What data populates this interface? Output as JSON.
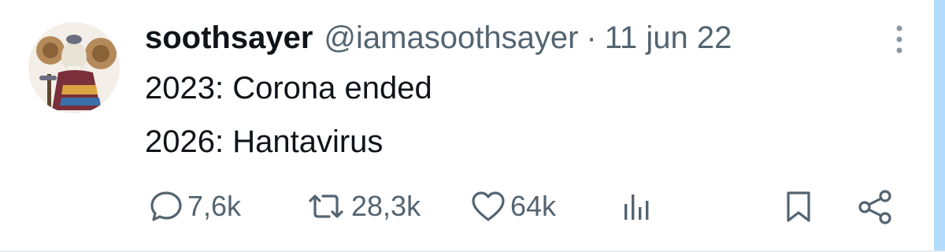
{
  "tweet": {
    "author": {
      "display_name": "soothsayer",
      "handle": "@iamasoothsayer",
      "avatar_icon": "ram-soothsayer-avatar"
    },
    "separator": "·",
    "date": "11 jun 22",
    "lines": [
      "2023: Corona ended",
      "2026: Hantavirus"
    ],
    "actions": {
      "replies": "7,6k",
      "retweets": "28,3k",
      "likes": "64k"
    },
    "icons": {
      "more": "more-vertical-icon",
      "reply": "reply-bubble-icon",
      "retweet": "retweet-icon",
      "like": "heart-icon",
      "views": "analytics-bars-icon",
      "bookmark": "bookmark-icon",
      "share": "share-icon"
    },
    "colors": {
      "text": "#0f1419",
      "secondary": "#536471",
      "accent": "#1d9bf0"
    }
  }
}
